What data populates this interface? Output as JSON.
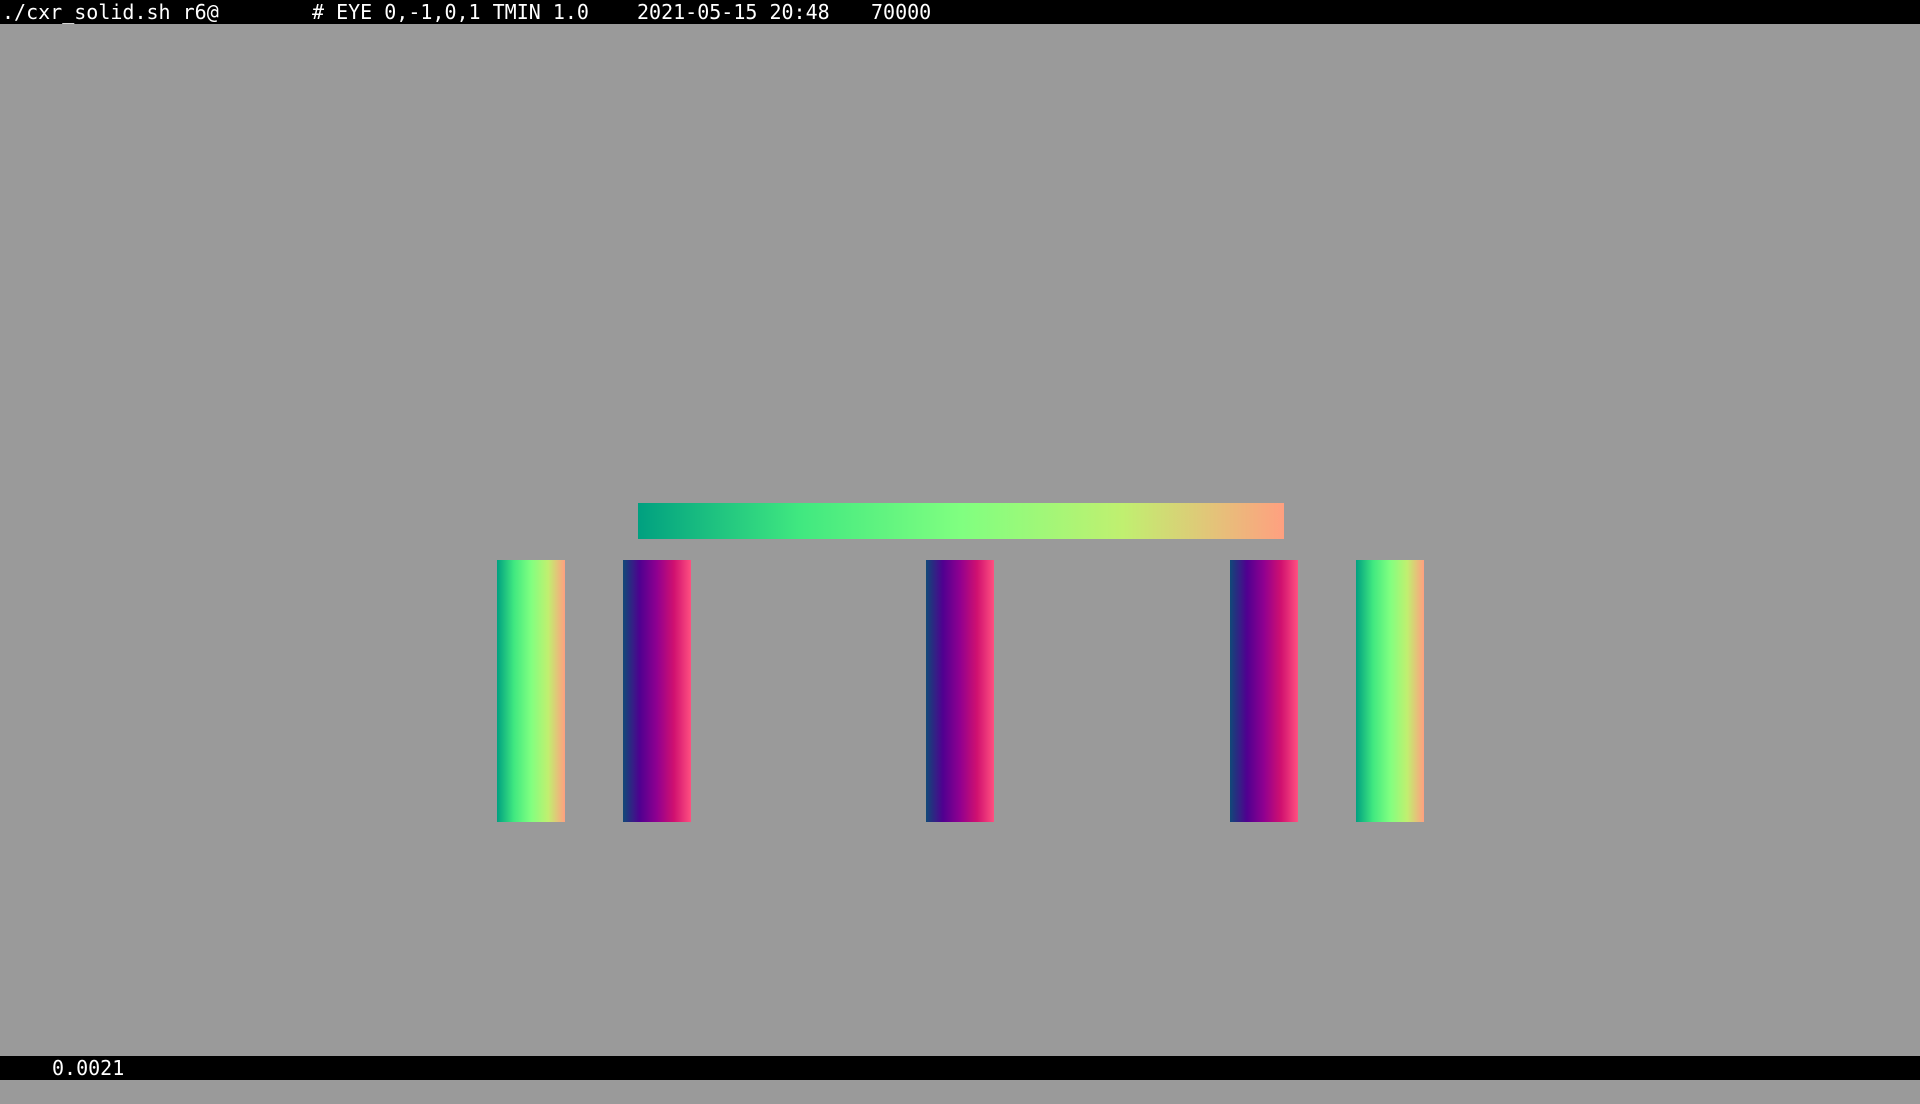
{
  "topbar": {
    "command": "./cxr_solid.sh r6@",
    "eye": "# EYE 0,-1,0,1 TMIN 1.0",
    "datetime": "2021-05-15 20:48",
    "count": "70000"
  },
  "bottombar": {
    "render_time": "0.0021"
  },
  "colors": {
    "background": "#9a9a9a",
    "bars": "#000000",
    "green_gradient": [
      "#00a080",
      "#40e880",
      "#80ff80",
      "#c0f070",
      "#ffa080"
    ],
    "magenta_gradient": [
      "#104878",
      "#500090",
      "#900090",
      "#d01070",
      "#ff5080"
    ]
  },
  "scene": {
    "shapes": [
      "beam",
      "pillar-outer-left",
      "pillar-inner-left",
      "pillar-center",
      "pillar-inner-right",
      "pillar-outer-right"
    ]
  }
}
